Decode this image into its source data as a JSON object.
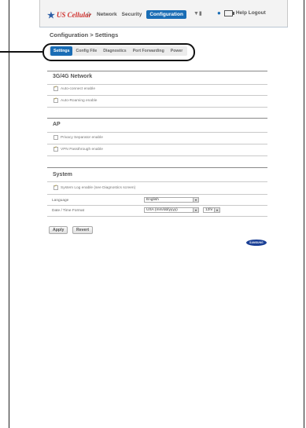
{
  "header": {
    "logo_text": "US Cellular",
    "nav": [
      "Network",
      "Security",
      "Configuration"
    ],
    "active_nav": "Configuration",
    "right_links": "Help  Logout",
    "home_icon": "home-icon",
    "signal_icon": "signal-icon",
    "user_icon": "user-icon",
    "battery_icon": "battery-icon"
  },
  "page": {
    "title": "Configuration > Settings"
  },
  "tabs": {
    "items": [
      "Settings",
      "Config File",
      "Diagnostics",
      "Port Forwarding",
      "Power"
    ],
    "active": "Settings"
  },
  "sections": {
    "network": {
      "title": "3G/4G Network",
      "auto_connect": "Auto-connect enable",
      "auto_roaming": "Auto-Roaming enable"
    },
    "ap": {
      "title": "AP",
      "privacy": "Privacy Separator enable",
      "vpn": "VPN Passthrough enable"
    },
    "system": {
      "title": "System",
      "syslog": "System Log enable (see Diagnostics screen)",
      "language_label": "Language",
      "language_value": "English",
      "datetime_label": "Date / Time Format",
      "date_value": "USA (mm/dd/yyyy)",
      "time_value": "12hr"
    }
  },
  "checkboxes": {
    "auto_connect": true,
    "auto_roaming": true,
    "privacy": false,
    "vpn": true,
    "syslog": true
  },
  "buttons": {
    "apply": "Apply",
    "revert": "Revert"
  },
  "footer": {
    "brand": "SAMSUNG"
  },
  "colors": {
    "accent": "#1a6db5",
    "brand_blue": "#2e5fa6",
    "brand_red": "#d0312d",
    "samsung_blue": "#1a3f95"
  }
}
